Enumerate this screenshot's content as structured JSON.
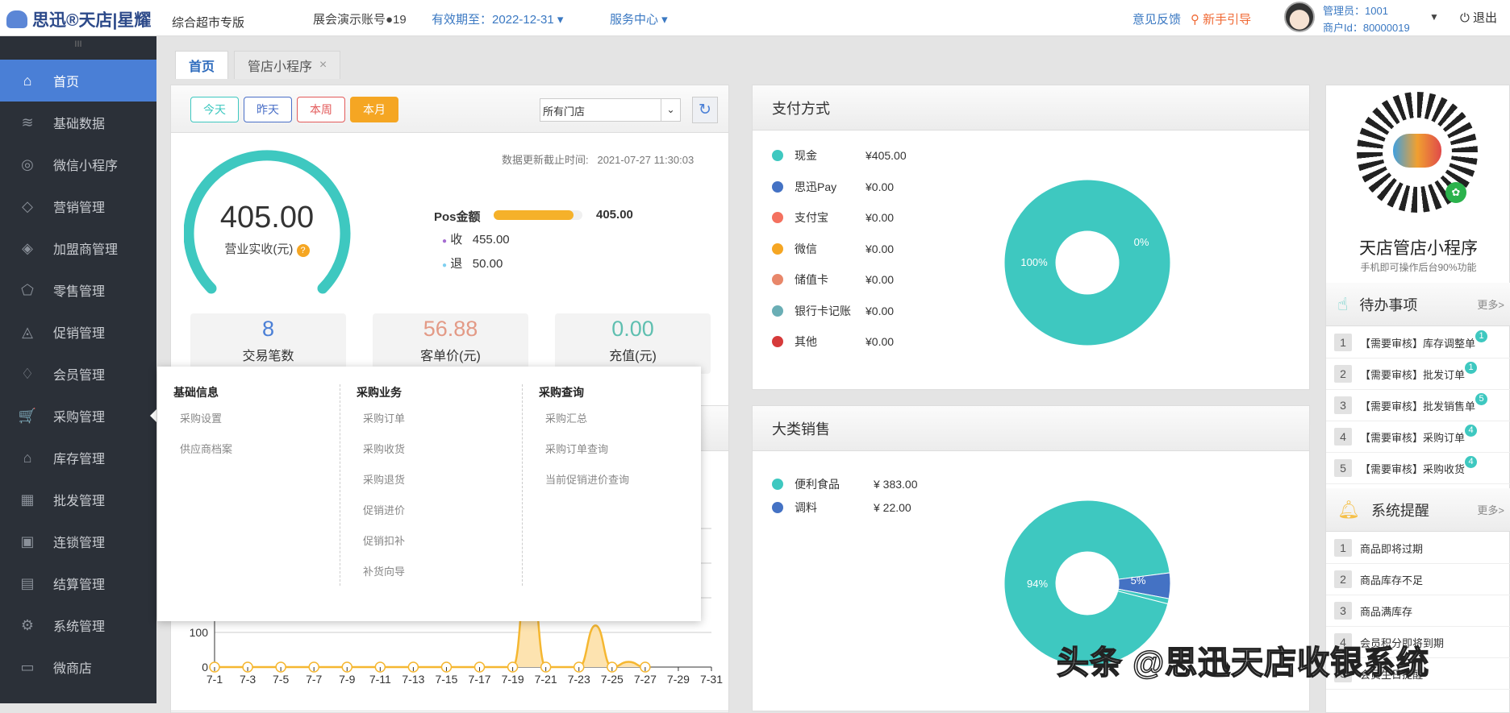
{
  "header": {
    "logo": "思迅®天店|星耀",
    "edition": "综合超市专版",
    "account": "展会演示账号●19",
    "expiry": "有效期至：2022-12-31",
    "service": "服务中心",
    "feedback": "意见反馈",
    "guide": "新手引导",
    "admin": "管理员：1001",
    "merchant": "商户Id：80000019",
    "logout": "退出"
  },
  "sidebar": {
    "grip": "III",
    "items": [
      {
        "label": "首页",
        "icon": "home-icon",
        "g": "⌂"
      },
      {
        "label": "基础数据",
        "icon": "layers-icon",
        "g": "≋"
      },
      {
        "label": "微信小程序",
        "icon": "miniprogram-icon",
        "g": "◎"
      },
      {
        "label": "营销管理",
        "icon": "diamond-icon",
        "g": "◇"
      },
      {
        "label": "加盟商管理",
        "icon": "tag-icon",
        "g": "◈"
      },
      {
        "label": "零售管理",
        "icon": "price-tag-icon",
        "g": "⬠"
      },
      {
        "label": "促销管理",
        "icon": "megaphone-icon",
        "g": "◬"
      },
      {
        "label": "会员管理",
        "icon": "vip-icon",
        "g": "♢"
      },
      {
        "label": "采购管理",
        "icon": "cart-icon",
        "g": "🛒"
      },
      {
        "label": "库存管理",
        "icon": "warehouse-icon",
        "g": "⌂"
      },
      {
        "label": "批发管理",
        "icon": "boxes-icon",
        "g": "▦"
      },
      {
        "label": "连锁管理",
        "icon": "chain-store-icon",
        "g": "▣"
      },
      {
        "label": "结算管理",
        "icon": "settlement-icon",
        "g": "▤"
      },
      {
        "label": "系统管理",
        "icon": "gear-icon",
        "g": "⚙"
      },
      {
        "label": "微商店",
        "icon": "shop-icon",
        "g": "▭"
      }
    ]
  },
  "tabs": [
    {
      "label": "首页"
    },
    {
      "label": "管店小程序",
      "close": "×"
    }
  ],
  "filters": {
    "today": "今天",
    "yesterday": "昨天",
    "week": "本周",
    "month": "本月",
    "store": "所有门店"
  },
  "overview": {
    "updated_label": "数据更新截止时间:",
    "updated_time": "2021-07-27 11:30:03",
    "revenue": "405.00",
    "revenue_label": "营业实收(元)",
    "pos_label": "Pos金额",
    "pos_value": "405.00",
    "pos_fill": 1.0,
    "income_label": "收",
    "income": "455.00",
    "refund_label": "退",
    "refund": "50.00",
    "stats": [
      {
        "value": "8",
        "label": "交易笔数",
        "color": "#4a7fd6"
      },
      {
        "value": "56.88",
        "label": "客单价(元)",
        "color": "#e39a86"
      },
      {
        "value": "0.00",
        "label": "充值(元)",
        "color": "#5fbfb0"
      }
    ]
  },
  "purchase_menu": {
    "cols": [
      {
        "title": "基础信息",
        "items": [
          "采购设置",
          "供应商档案"
        ]
      },
      {
        "title": "采购业务",
        "items": [
          "采购订单",
          "采购收货",
          "采购退货",
          "促销进价",
          "促销扣补",
          "补货向导"
        ]
      },
      {
        "title": "采购查询",
        "items": [
          "采购汇总",
          "采购订单查询",
          "当前促销进价查询"
        ]
      }
    ]
  },
  "payment": {
    "title": "支付方式",
    "items": [
      {
        "name": "现金",
        "amount": "¥405.00",
        "color": "#3ec8c0"
      },
      {
        "name": "思迅Pay",
        "amount": "¥0.00",
        "color": "#4472c4"
      },
      {
        "name": "支付宝",
        "amount": "¥0.00",
        "color": "#f4715f"
      },
      {
        "name": "微信",
        "amount": "¥0.00",
        "color": "#f5a623"
      },
      {
        "name": "储值卡",
        "amount": "¥0.00",
        "color": "#e8876a"
      },
      {
        "name": "银行卡记账",
        "amount": "¥0.00",
        "color": "#6aaeb5"
      },
      {
        "name": "其他",
        "amount": "¥0.00",
        "color": "#d63a3a"
      }
    ],
    "pie_labels": [
      "100%",
      "0%"
    ]
  },
  "category": {
    "title": "大类销售",
    "items": [
      {
        "name": "便利食品",
        "amount": "¥ 383.00",
        "color": "#3ec8c0",
        "pct": 94
      },
      {
        "name": "调料",
        "amount": "¥ 22.00",
        "color": "#4472c4",
        "pct": 5
      }
    ],
    "pie_labels": [
      "94%",
      "5%"
    ]
  },
  "chart_data": {
    "type": "area",
    "x": [
      "7-1",
      "7-3",
      "7-5",
      "7-7",
      "7-9",
      "7-11",
      "7-13",
      "7-15",
      "7-17",
      "7-19",
      "7-21",
      "7-23",
      "7-25",
      "7-27",
      "7-29",
      "7-31"
    ],
    "yticks": [
      "0",
      "100"
    ],
    "ylim": [
      0,
      500
    ],
    "daily": [
      0,
      0,
      0,
      0,
      0,
      0,
      0,
      0,
      0,
      0,
      0,
      0,
      0,
      0,
      0,
      0,
      0,
      0,
      0,
      320,
      0,
      0,
      0,
      120,
      0,
      15,
      0
    ],
    "color": "#f5b731"
  },
  "right": {
    "qr_title": "天店管店小程序",
    "qr_sub": "手机即可操作后台90%功能",
    "todo_title": "待办事项",
    "more": "更多>",
    "todos": [
      {
        "n": "1",
        "text": "【需要审核】库存调整单",
        "badge": "1"
      },
      {
        "n": "2",
        "text": "【需要审核】批发订单",
        "badge": "1"
      },
      {
        "n": "3",
        "text": "【需要审核】批发销售单",
        "badge": "5"
      },
      {
        "n": "4",
        "text": "【需要审核】采购订单",
        "badge": "4"
      },
      {
        "n": "5",
        "text": "【需要审核】采购收货",
        "badge": "4"
      }
    ],
    "remind_title": "系统提醒",
    "reminds": [
      {
        "n": "1",
        "text": "商品即将过期"
      },
      {
        "n": "2",
        "text": "商品库存不足"
      },
      {
        "n": "3",
        "text": "商品满库存"
      },
      {
        "n": "4",
        "text": "会员积分即将到期"
      },
      {
        "n": "5",
        "text": "会员生日提醒"
      }
    ]
  },
  "watermark": "头条 @思迅天店收银系统"
}
